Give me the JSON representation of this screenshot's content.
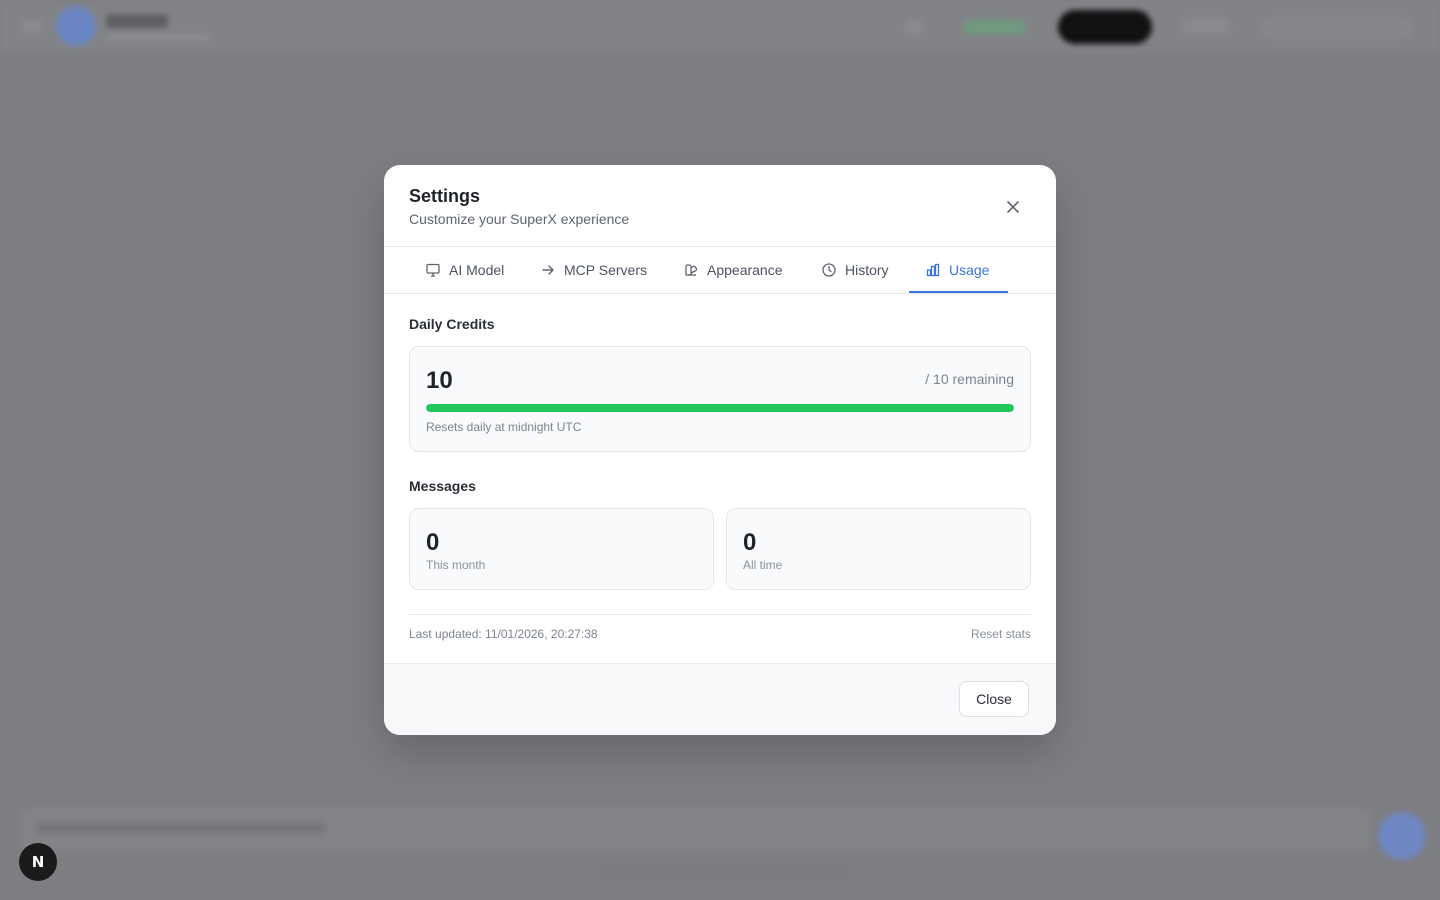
{
  "dialog": {
    "title": "Settings",
    "subtitle": "Customize your SuperX experience",
    "close_icon": "close-icon"
  },
  "tabs": [
    {
      "label": "AI Model",
      "icon": "monitor-icon",
      "active": false
    },
    {
      "label": "MCP Servers",
      "icon": "arrow-right-icon",
      "active": false
    },
    {
      "label": "Appearance",
      "icon": "palette-icon",
      "active": false
    },
    {
      "label": "History",
      "icon": "clock-icon",
      "active": false
    },
    {
      "label": "Usage",
      "icon": "bar-chart-icon",
      "active": true
    }
  ],
  "usage": {
    "daily_credits": {
      "heading": "Daily Credits",
      "value": "10",
      "remaining_text": "/ 10 remaining",
      "progress_fraction": 1.0,
      "progress_color": "#22c55e",
      "note": "Resets daily at midnight UTC"
    },
    "messages": {
      "heading": "Messages",
      "this_month": {
        "value": "0",
        "label": "This month"
      },
      "all_time": {
        "value": "0",
        "label": "All time"
      }
    },
    "last_updated": "Last updated: 11/01/2026, 20:27:38",
    "reset_label": "Reset stats"
  },
  "footer": {
    "close_label": "Close"
  },
  "badge": {
    "letter": "N"
  },
  "colors": {
    "accent": "#3b74e0",
    "success": "#22c55e",
    "overlay": "#7d7e82"
  }
}
